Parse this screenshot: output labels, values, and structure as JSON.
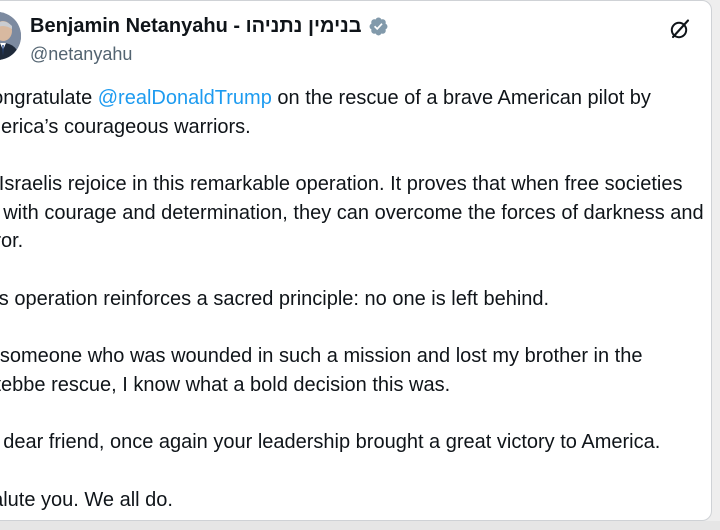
{
  "author": {
    "display_name": "Benjamin Netanyahu - בנימין נתניהו",
    "handle": "@netanyahu",
    "verified_icon": "verified-badge-gray",
    "avatar_icon": "profile-photo"
  },
  "actions": {
    "grok_icon": "grok-slash-icon"
  },
  "post": {
    "p1": {
      "before": "I congratulate ",
      "mention": "@realDonaldTrump",
      "after": " on the rescue of a brave American pilot by",
      "line2": "America’s courageous warriors."
    },
    "p2": {
      "line1": "All Israelis rejoice in this remarkable operation. It proves that when free societies",
      "line2": "act with courage and determination, they can overcome the forces of darkness and",
      "line3": "terror."
    },
    "p3": {
      "line1": "This operation reinforces a sacred principle: no one is left behind."
    },
    "p4": {
      "line1": "As someone who was wounded in such a mission and lost my brother in the",
      "line2": "Entebbe rescue, I know what a bold decision this was."
    },
    "p5": {
      "line1": "My dear friend, once again your leadership brought a great victory to America."
    },
    "p6": {
      "line1": "I salute you. We all do."
    }
  },
  "colors": {
    "text": "#0f1419",
    "secondary": "#536471",
    "link": "#1d9bf0",
    "verified": "#829aab"
  }
}
